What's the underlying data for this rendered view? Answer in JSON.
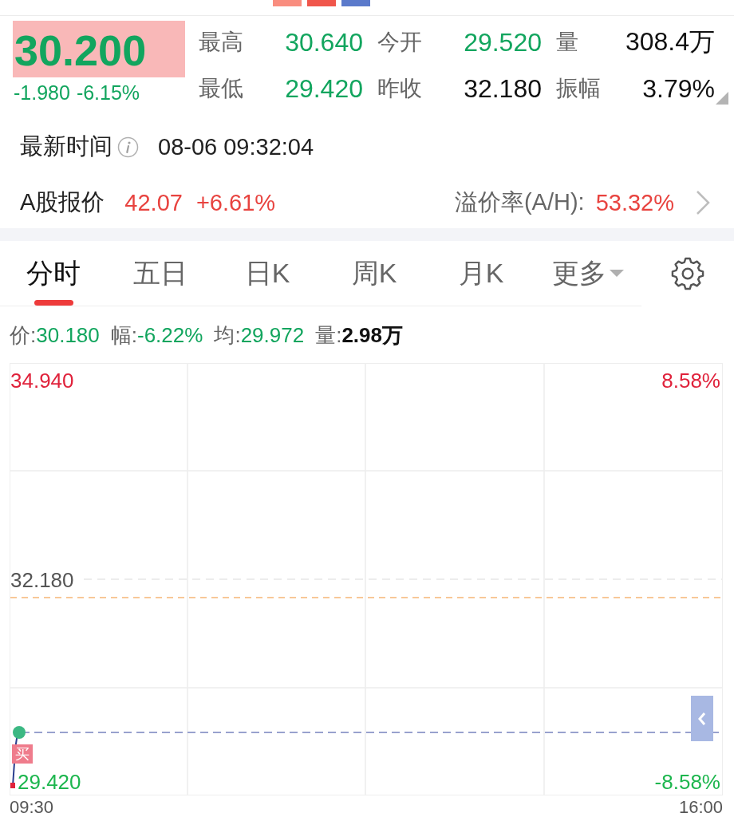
{
  "header": {
    "market_tags": [
      {
        "color": "#f98d7f"
      },
      {
        "color": "#f0564b"
      },
      {
        "color": "#5b7acb"
      }
    ]
  },
  "quote": {
    "price": "30.200",
    "change": "-1.980",
    "change_pct": "-6.15%",
    "falling": true
  },
  "stats": [
    {
      "label": "最高",
      "value": "30.640",
      "color": "#12a55e"
    },
    {
      "label": "今开",
      "value": "29.520",
      "color": "#12a55e"
    },
    {
      "label": "量",
      "value": "308.4万",
      "color": "#111111"
    },
    {
      "label": "最低",
      "value": "29.420",
      "color": "#12a55e"
    },
    {
      "label": "昨收",
      "value": "32.180",
      "color": "#111111"
    },
    {
      "label": "振幅",
      "value": "3.79%",
      "color": "#111111"
    }
  ],
  "latest_time": {
    "label": "最新时间",
    "value": "08-06 09:32:04"
  },
  "a_share": {
    "label": "A股报价",
    "price": "42.07",
    "change_pct": "+6.61%",
    "rising": true,
    "premium_label": "溢价率(A/H):",
    "premium": "53.32%",
    "premium_rising": true
  },
  "tabs": [
    {
      "label": "分时",
      "selected": true,
      "kind": "tab"
    },
    {
      "label": "五日",
      "selected": false,
      "kind": "tab"
    },
    {
      "label": "日K",
      "selected": false,
      "kind": "tab"
    },
    {
      "label": "周K",
      "selected": false,
      "kind": "tab"
    },
    {
      "label": "月K",
      "selected": false,
      "kind": "tab"
    },
    {
      "label": "更多",
      "selected": false,
      "kind": "menu"
    }
  ],
  "intraday_summary": [
    {
      "label": "价:",
      "value": "30.180",
      "color": "#12a55e"
    },
    {
      "label": "幅:",
      "value": "-6.22%",
      "color": "#12a55e"
    },
    {
      "label": "均:",
      "value": "29.972",
      "color": "#12a55e"
    },
    {
      "label": "量:",
      "value": "2.98万",
      "color": "#111111"
    }
  ],
  "chart": {
    "price_scale": [
      {
        "text": "34.940",
        "color": "#e0223b"
      },
      {
        "text": "32.180",
        "color": "#555555"
      },
      {
        "text": "29.420",
        "color": "#1db64e"
      }
    ],
    "percent_scale": [
      {
        "text": "8.58%",
        "color": "#e0223b"
      },
      {
        "text": "-8.58%",
        "color": "#1db64e"
      }
    ],
    "trade_marker": "买",
    "time_axis": [
      "09:30",
      "16:00"
    ]
  }
}
